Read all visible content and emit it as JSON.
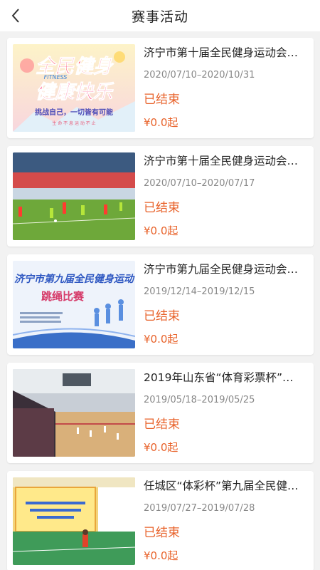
{
  "header": {
    "title": "赛事活动",
    "back_icon": "chevron-left-icon"
  },
  "events": [
    {
      "name": "济宁市第十届全民健身运动会…",
      "date": "2020/07/10–2020/10/31",
      "status": "已结束",
      "price": "¥0.0起",
      "poster": {
        "line1": "全民健身",
        "english": "FITNESS",
        "line2": "健康快乐",
        "slogan": "挑战自己，一切皆有可能",
        "motto": "生 命 不 息    运 动 不 止"
      }
    },
    {
      "name": "济宁市第十届全民健身运动会…",
      "date": "2020/07/10–2020/07/17",
      "status": "已结束",
      "price": "¥0.0起"
    },
    {
      "name": "济宁市第九届全民健身运动会…",
      "date": "2019/12/14–2019/12/15",
      "status": "已结束",
      "price": "¥0.0起",
      "poster": {
        "line1": "济宁市第九届全民健身运动",
        "line2": "跳绳比赛"
      }
    },
    {
      "name": "2019年山东省“体育彩票杯”…",
      "date": "2019/05/18–2019/05/25",
      "status": "已结束",
      "price": "¥0.0起"
    },
    {
      "name": "任城区“体彩杯”第九届全民健…",
      "date": "2019/07/27–2019/07/28",
      "status": "已结束",
      "price": "¥0.0起"
    }
  ],
  "colors": {
    "accent": "#e8622a",
    "background": "#f2f2f2"
  }
}
